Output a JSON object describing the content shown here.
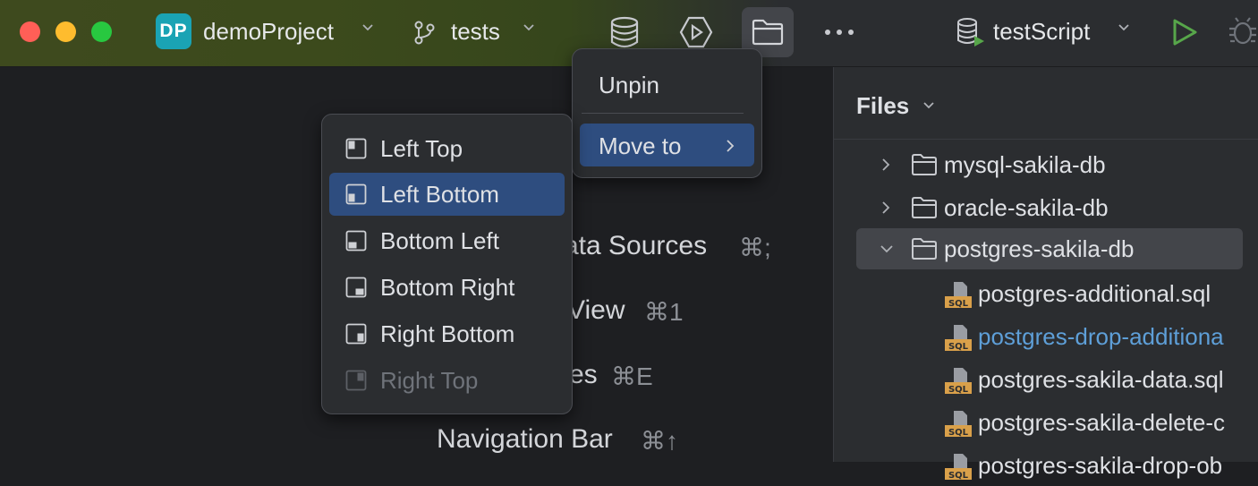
{
  "window": {
    "project_badge": "DP",
    "project_name": "demoProject",
    "branch_name": "tests",
    "run_config": "testScript"
  },
  "toolbar_icons": [
    "database-icon",
    "services-icon",
    "folder-icon",
    "more-icon",
    "run-icon",
    "debug-icon"
  ],
  "files_panel": {
    "title": "Files",
    "tree": [
      {
        "label": "mysql-sakila-db",
        "type": "folder",
        "expanded": false
      },
      {
        "label": "oracle-sakila-db",
        "type": "folder",
        "expanded": false
      },
      {
        "label": "postgres-sakila-db",
        "type": "folder",
        "expanded": true,
        "selected": true
      },
      {
        "label": "postgres-additional.sql",
        "type": "sql"
      },
      {
        "label": "postgres-drop-additiona",
        "type": "sql",
        "highlighted": true
      },
      {
        "label": "postgres-sakila-data.sql",
        "type": "sql"
      },
      {
        "label": "postgres-sakila-delete-c",
        "type": "sql"
      },
      {
        "label": "postgres-sakila-drop-ob",
        "type": "sql"
      }
    ]
  },
  "empty_state_hints": [
    {
      "label": "ata Sources",
      "shortcut": "⌘;"
    },
    {
      "label": "View",
      "shortcut": "⌘1"
    },
    {
      "label": "es",
      "shortcut": "⌘E"
    },
    {
      "label": "Navigation Bar",
      "shortcut": "⌘↑"
    }
  ],
  "context_menu": {
    "items": [
      {
        "label": "Unpin"
      },
      {
        "label": "Move to",
        "has_submenu": true
      }
    ]
  },
  "move_submenu": {
    "items": [
      {
        "label": "Left Top",
        "icon": "left-top-layout-icon",
        "enabled": true
      },
      {
        "label": "Left Bottom",
        "icon": "left-bottom-layout-icon",
        "enabled": true,
        "selected": true
      },
      {
        "label": "Bottom Left",
        "icon": "bottom-left-layout-icon",
        "enabled": true
      },
      {
        "label": "Bottom Right",
        "icon": "bottom-right-layout-icon",
        "enabled": true
      },
      {
        "label": "Right Bottom",
        "icon": "right-bottom-layout-icon",
        "enabled": true
      },
      {
        "label": "Right Top",
        "icon": "right-top-layout-icon",
        "enabled": false
      }
    ]
  },
  "colors": {
    "selection": "#2e4d7f",
    "sql_icon": "#d9a04a",
    "run_green": "#57a64a",
    "link_blue": "#5e9fd8"
  }
}
